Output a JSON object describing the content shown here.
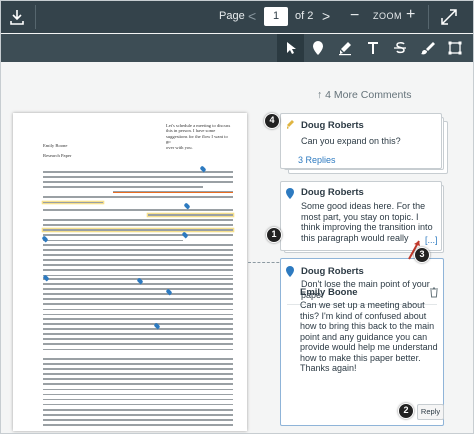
{
  "toolbar": {
    "page_label": "Page",
    "page_value": "1",
    "page_total": "of 2",
    "zoom_label": "ZOOM",
    "zoom_minus": "−",
    "zoom_plus": "+",
    "prev": "<",
    "next": ">"
  },
  "tools": [
    "pointer-tool",
    "point-annotation-tool",
    "highlight-tool",
    "text-tool",
    "strikeout-tool",
    "freehand-tool",
    "area-tool"
  ],
  "document": {
    "note_lines": [
      "Let's schedule a meeting to discuss",
      "this in person. I have some",
      "suggestions for the flow I want to go",
      "over with you."
    ],
    "author": "Emily Boone",
    "paper_title": "Research Paper"
  },
  "comments": {
    "more_label": "4 More Comments",
    "items": [
      {
        "author": "Doug Roberts",
        "body": "Can you expand on this?",
        "replies": "3 Replies"
      },
      {
        "author": "Doug Roberts",
        "body": "Some good ideas here. For the most part, you stay on topic. I think improving the transition into this paragraph would really strengthen the point you're trying to make. T",
        "more": "[...]"
      },
      {
        "author": "Doug Roberts",
        "body": "Don't lose the main point of your paper"
      },
      {
        "author": "Emily Boone",
        "body": "Can we set up a meeting about this? I'm kind of confused about how to bring this back to the main point and any guidance you can provide would help me understand how to make this paper better. Thanks again!"
      }
    ],
    "reply_button": "Reply"
  },
  "callouts": [
    "1",
    "2",
    "3",
    "4"
  ],
  "colors": {
    "topbar": "#34434b",
    "toolbar": "#3d4d55",
    "link": "#2d7ac0",
    "highlight": "#f5df8c",
    "underline": "#e86c22",
    "annotation_outline": "#2d7ac0"
  }
}
